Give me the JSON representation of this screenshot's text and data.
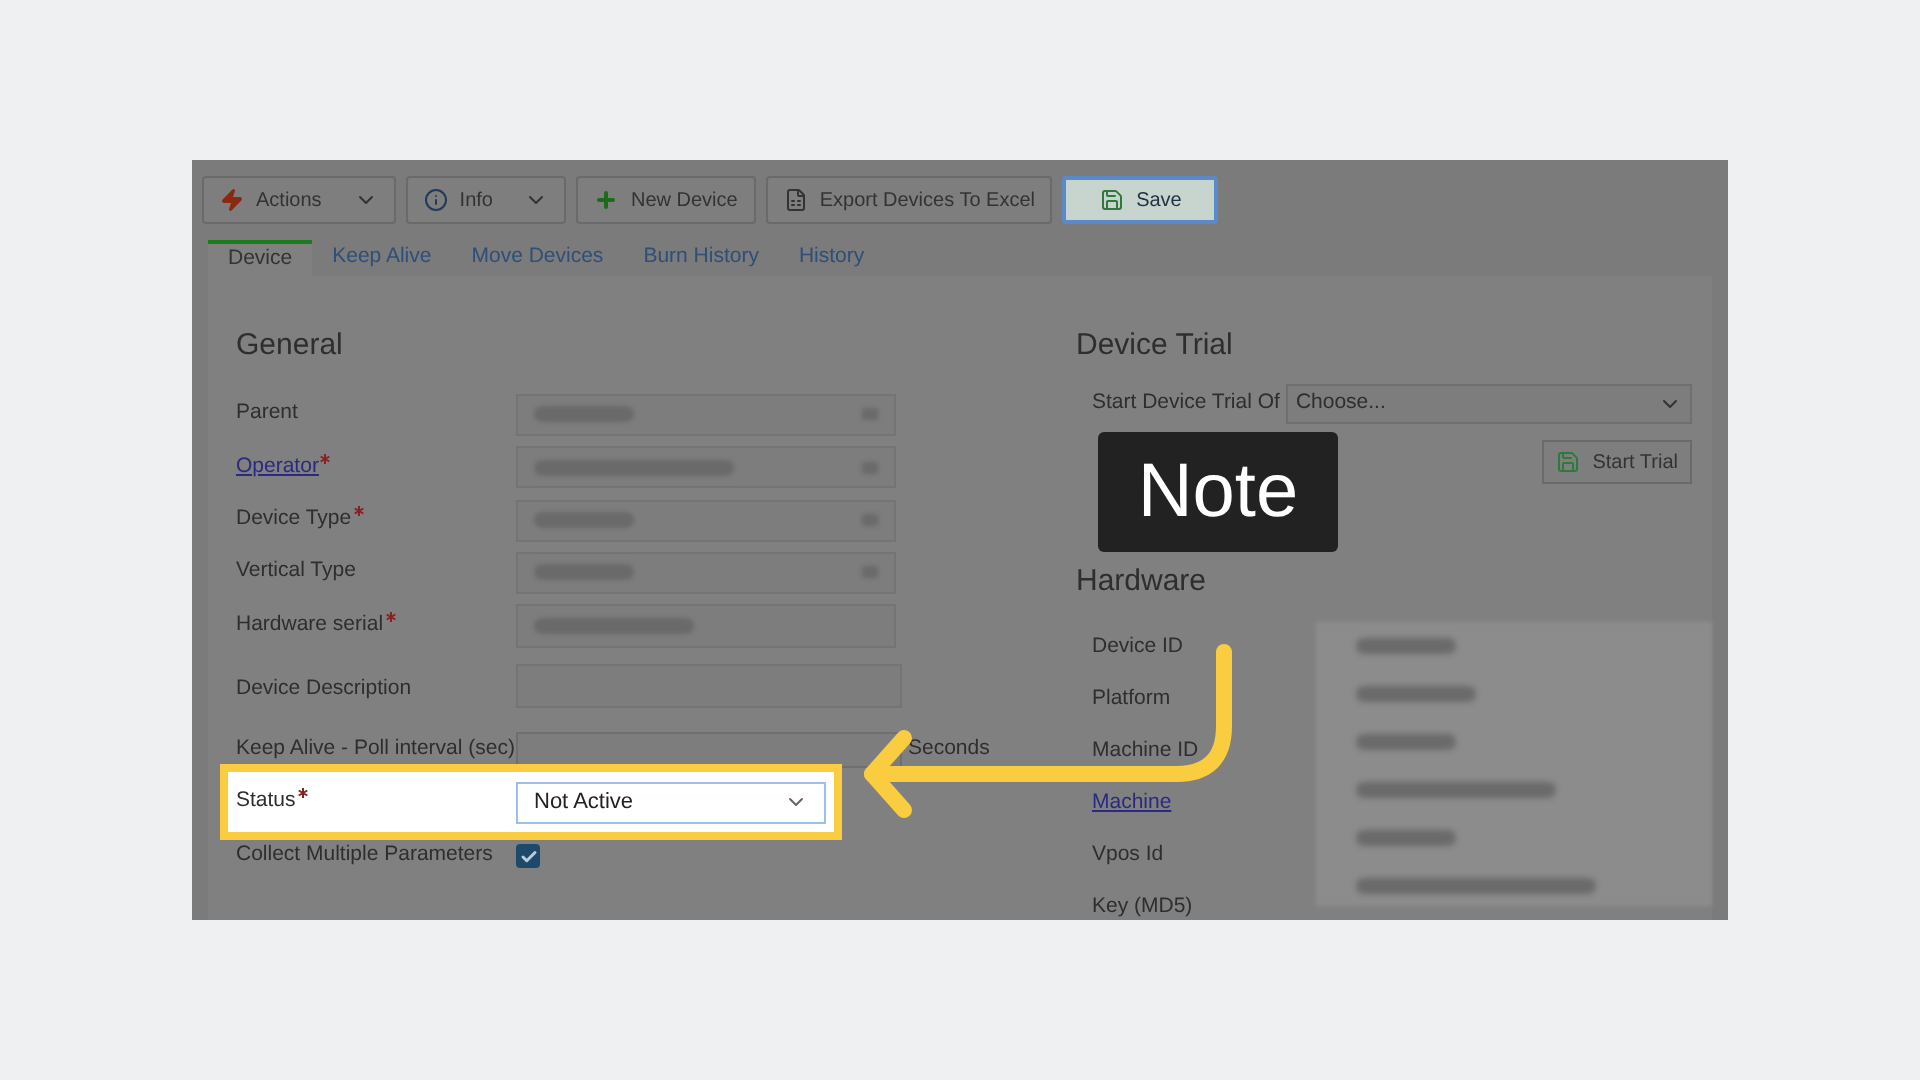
{
  "toolbar": [
    {
      "label": "Actions",
      "kind": "dropdown",
      "highlighted": false
    },
    {
      "label": "Info",
      "kind": "dropdown",
      "highlighted": false
    },
    {
      "label": "New Device",
      "kind": "plain",
      "highlighted": false
    },
    {
      "label": "Export Devices To Excel",
      "kind": "plain",
      "highlighted": false
    },
    {
      "label": "Save",
      "kind": "plain",
      "highlighted": true
    }
  ],
  "tabs": [
    {
      "label": "Device",
      "selected": true
    },
    {
      "label": "Keep Alive",
      "selected": false
    },
    {
      "label": "Move Devices",
      "selected": false
    },
    {
      "label": "Burn History",
      "selected": false
    },
    {
      "label": "History",
      "selected": false
    }
  ],
  "general": {
    "title": "General",
    "fields": [
      {
        "label": "Parent",
        "kind": "select",
        "required": false,
        "link": false,
        "highlighted": false
      },
      {
        "label": "Operator",
        "kind": "select",
        "required": true,
        "link": true,
        "highlighted": false
      },
      {
        "label": "Device Type",
        "kind": "select",
        "required": true,
        "link": false,
        "highlighted": false
      },
      {
        "label": "Vertical Type",
        "kind": "select",
        "required": false,
        "link": false,
        "highlighted": false
      },
      {
        "label": "Hardware serial",
        "kind": "text",
        "required": true,
        "link": false,
        "highlighted": false
      },
      {
        "label": "Device Description",
        "kind": "textarea",
        "required": false,
        "link": false,
        "highlighted": false
      },
      {
        "label": "Keep Alive - Poll interval (sec)",
        "kind": "suffix",
        "suffix": "Seconds",
        "required": false,
        "link": false,
        "highlighted": false
      },
      {
        "label": "Status",
        "kind": "select",
        "value": "Not Active",
        "required": true,
        "link": false,
        "highlighted": true
      },
      {
        "label": "Collect Multiple Parameters",
        "kind": "checkbox",
        "checked": true,
        "required": false,
        "link": false,
        "highlighted": false
      }
    ]
  },
  "device_trial": {
    "title": "Device Trial",
    "label": "Start Device Trial Of",
    "placeholder": "Choose...",
    "button": "Start Trial"
  },
  "hardware": {
    "title": "Hardware",
    "fields": [
      {
        "label": "Device ID",
        "link": false
      },
      {
        "label": "Platform",
        "link": false
      },
      {
        "label": "Machine ID",
        "link": false
      },
      {
        "label": "Machine",
        "link": true
      },
      {
        "label": "Vpos Id",
        "link": false
      },
      {
        "label": "Key (MD5)",
        "link": false
      }
    ]
  },
  "annotation": {
    "text": "Note"
  }
}
